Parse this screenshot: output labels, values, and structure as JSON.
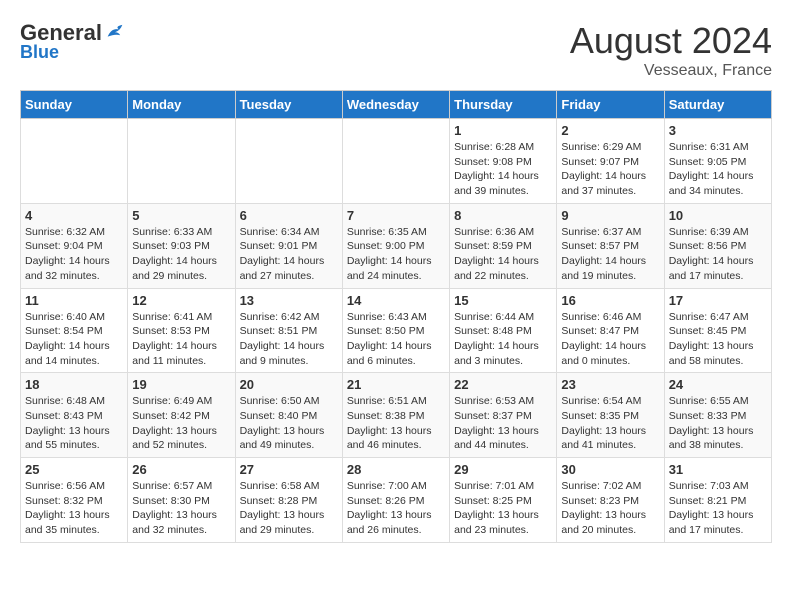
{
  "header": {
    "logo_general": "General",
    "logo_blue": "Blue",
    "month": "August 2024",
    "location": "Vesseaux, France"
  },
  "days_of_week": [
    "Sunday",
    "Monday",
    "Tuesday",
    "Wednesday",
    "Thursday",
    "Friday",
    "Saturday"
  ],
  "weeks": [
    [
      {
        "day": "",
        "info": ""
      },
      {
        "day": "",
        "info": ""
      },
      {
        "day": "",
        "info": ""
      },
      {
        "day": "",
        "info": ""
      },
      {
        "day": "1",
        "info": "Sunrise: 6:28 AM\nSunset: 9:08 PM\nDaylight: 14 hours and 39 minutes."
      },
      {
        "day": "2",
        "info": "Sunrise: 6:29 AM\nSunset: 9:07 PM\nDaylight: 14 hours and 37 minutes."
      },
      {
        "day": "3",
        "info": "Sunrise: 6:31 AM\nSunset: 9:05 PM\nDaylight: 14 hours and 34 minutes."
      }
    ],
    [
      {
        "day": "4",
        "info": "Sunrise: 6:32 AM\nSunset: 9:04 PM\nDaylight: 14 hours and 32 minutes."
      },
      {
        "day": "5",
        "info": "Sunrise: 6:33 AM\nSunset: 9:03 PM\nDaylight: 14 hours and 29 minutes."
      },
      {
        "day": "6",
        "info": "Sunrise: 6:34 AM\nSunset: 9:01 PM\nDaylight: 14 hours and 27 minutes."
      },
      {
        "day": "7",
        "info": "Sunrise: 6:35 AM\nSunset: 9:00 PM\nDaylight: 14 hours and 24 minutes."
      },
      {
        "day": "8",
        "info": "Sunrise: 6:36 AM\nSunset: 8:59 PM\nDaylight: 14 hours and 22 minutes."
      },
      {
        "day": "9",
        "info": "Sunrise: 6:37 AM\nSunset: 8:57 PM\nDaylight: 14 hours and 19 minutes."
      },
      {
        "day": "10",
        "info": "Sunrise: 6:39 AM\nSunset: 8:56 PM\nDaylight: 14 hours and 17 minutes."
      }
    ],
    [
      {
        "day": "11",
        "info": "Sunrise: 6:40 AM\nSunset: 8:54 PM\nDaylight: 14 hours and 14 minutes."
      },
      {
        "day": "12",
        "info": "Sunrise: 6:41 AM\nSunset: 8:53 PM\nDaylight: 14 hours and 11 minutes."
      },
      {
        "day": "13",
        "info": "Sunrise: 6:42 AM\nSunset: 8:51 PM\nDaylight: 14 hours and 9 minutes."
      },
      {
        "day": "14",
        "info": "Sunrise: 6:43 AM\nSunset: 8:50 PM\nDaylight: 14 hours and 6 minutes."
      },
      {
        "day": "15",
        "info": "Sunrise: 6:44 AM\nSunset: 8:48 PM\nDaylight: 14 hours and 3 minutes."
      },
      {
        "day": "16",
        "info": "Sunrise: 6:46 AM\nSunset: 8:47 PM\nDaylight: 14 hours and 0 minutes."
      },
      {
        "day": "17",
        "info": "Sunrise: 6:47 AM\nSunset: 8:45 PM\nDaylight: 13 hours and 58 minutes."
      }
    ],
    [
      {
        "day": "18",
        "info": "Sunrise: 6:48 AM\nSunset: 8:43 PM\nDaylight: 13 hours and 55 minutes."
      },
      {
        "day": "19",
        "info": "Sunrise: 6:49 AM\nSunset: 8:42 PM\nDaylight: 13 hours and 52 minutes."
      },
      {
        "day": "20",
        "info": "Sunrise: 6:50 AM\nSunset: 8:40 PM\nDaylight: 13 hours and 49 minutes."
      },
      {
        "day": "21",
        "info": "Sunrise: 6:51 AM\nSunset: 8:38 PM\nDaylight: 13 hours and 46 minutes."
      },
      {
        "day": "22",
        "info": "Sunrise: 6:53 AM\nSunset: 8:37 PM\nDaylight: 13 hours and 44 minutes."
      },
      {
        "day": "23",
        "info": "Sunrise: 6:54 AM\nSunset: 8:35 PM\nDaylight: 13 hours and 41 minutes."
      },
      {
        "day": "24",
        "info": "Sunrise: 6:55 AM\nSunset: 8:33 PM\nDaylight: 13 hours and 38 minutes."
      }
    ],
    [
      {
        "day": "25",
        "info": "Sunrise: 6:56 AM\nSunset: 8:32 PM\nDaylight: 13 hours and 35 minutes."
      },
      {
        "day": "26",
        "info": "Sunrise: 6:57 AM\nSunset: 8:30 PM\nDaylight: 13 hours and 32 minutes."
      },
      {
        "day": "27",
        "info": "Sunrise: 6:58 AM\nSunset: 8:28 PM\nDaylight: 13 hours and 29 minutes."
      },
      {
        "day": "28",
        "info": "Sunrise: 7:00 AM\nSunset: 8:26 PM\nDaylight: 13 hours and 26 minutes."
      },
      {
        "day": "29",
        "info": "Sunrise: 7:01 AM\nSunset: 8:25 PM\nDaylight: 13 hours and 23 minutes."
      },
      {
        "day": "30",
        "info": "Sunrise: 7:02 AM\nSunset: 8:23 PM\nDaylight: 13 hours and 20 minutes."
      },
      {
        "day": "31",
        "info": "Sunrise: 7:03 AM\nSunset: 8:21 PM\nDaylight: 13 hours and 17 minutes."
      }
    ]
  ]
}
